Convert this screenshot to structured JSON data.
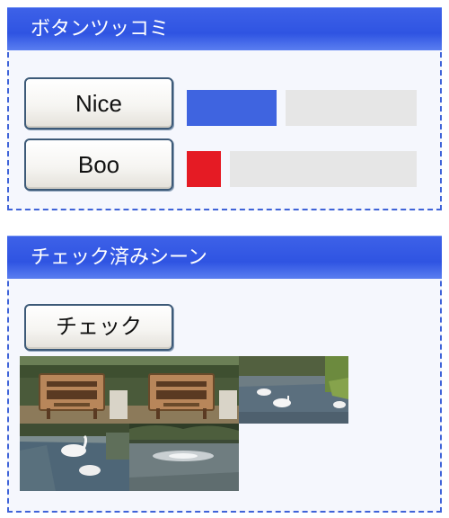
{
  "button_panel": {
    "title": "ボタンツッコミ",
    "votes": [
      {
        "label": "Nice",
        "share": 0.39,
        "color": "#3f64e0"
      },
      {
        "label": "Boo",
        "share": 0.15,
        "color": "#e51b24"
      }
    ],
    "track_color": "#e6e6e6"
  },
  "checked_scenes_panel": {
    "title": "チェック済みシーン",
    "check_button": "チェック",
    "scenes": [
      {
        "icon": "park-signboard-thumbnail"
      },
      {
        "icon": "park-signboard-thumbnail"
      },
      {
        "icon": "pond-swans-thumbnail"
      },
      {
        "icon": "swan-boats-thumbnail"
      },
      {
        "icon": "pond-fountain-thumbnail"
      }
    ]
  }
}
